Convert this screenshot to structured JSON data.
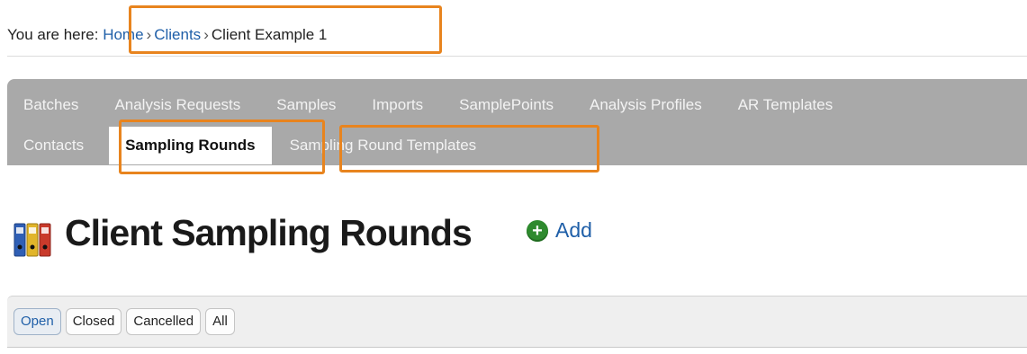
{
  "breadcrumb": {
    "prefix": "You are here:",
    "items": [
      "Home",
      "Clients"
    ],
    "current": "Client Example 1",
    "separator": "›"
  },
  "tabs": {
    "row1": [
      "Batches",
      "Analysis Requests",
      "Samples",
      "Imports",
      "SamplePoints",
      "Analysis Profiles",
      "AR Templates"
    ],
    "row2": [
      "Contacts",
      "Sampling Rounds",
      "Sampling Round Templates"
    ],
    "active": "Sampling Rounds"
  },
  "page": {
    "title": "Client Sampling Rounds",
    "icon": "binders-icon",
    "add_label": "Add",
    "add_icon": "plus-circle-icon"
  },
  "filters": {
    "buttons": [
      "Open",
      "Closed",
      "Cancelled",
      "All"
    ],
    "selected": "Open"
  },
  "colors": {
    "highlight": "#e8841e",
    "link": "#1f5fa8",
    "tabbar": "#a9a9a9"
  }
}
